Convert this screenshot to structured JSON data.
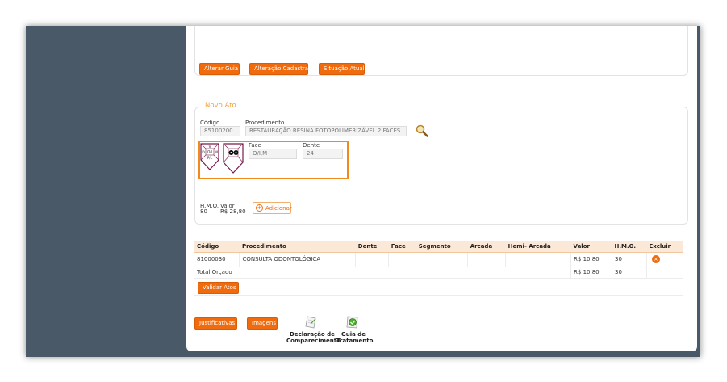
{
  "top_buttons": {
    "alterar_guia": "Alterar Guia",
    "alteracao_cadastral": "Alteração Cadastral",
    "situacao_atual": "Situação Atual"
  },
  "novo_ato": {
    "legend": "Novo Ato",
    "codigo_label": "Código",
    "codigo_value": "85100200",
    "procedimento_label": "Procedimento",
    "procedimento_value": "RESTAURAÇÃO RESINA FOTOPOLIMERIZÁVEL 2 FACES",
    "tooth_face_letters": {
      "top": "V",
      "left": "D",
      "center": "O/I",
      "right": "M",
      "bottom": "P/L"
    },
    "face_label": "Face",
    "face_value": "O/I,M",
    "dente_label": "Dente",
    "dente_value": "24",
    "hmo_label": "H.M.O.",
    "hmo_value": "80",
    "valor_label": "Valor",
    "valor_value": "R$ 28,80",
    "adicionar_label": "Adicionar"
  },
  "table": {
    "headers": [
      "Código",
      "Procedimento",
      "Dente",
      "Face",
      "Segmento",
      "Arcada",
      "Hemi- Arcada",
      "Valor",
      "H.M.O.",
      "Excluir"
    ],
    "rows": [
      {
        "codigo": "81000030",
        "procedimento": "CONSULTA ODONTOLÓGICA",
        "dente": "",
        "face": "",
        "segmento": "",
        "arcada": "",
        "hemi": "",
        "valor": "R$ 10,80",
        "hmo": "30"
      }
    ],
    "total_label": "Total Orçado",
    "total_valor": "R$ 10,80",
    "total_hmo": "30",
    "validar_label": "Validar Atos"
  },
  "bottom": {
    "justificativas_label": "Justificativas",
    "imagens_label": "Imagens",
    "declaracao_line1": "Declaração de",
    "declaracao_line2": "Comparecimento",
    "guia_line1": "Guia de",
    "guia_line2": "Tratamento"
  },
  "colors": {
    "accent": "#ef6b0e",
    "background": "#4a5967",
    "highlight_border": "#f08a1a",
    "tooth_stroke": "#7a1a4a"
  }
}
